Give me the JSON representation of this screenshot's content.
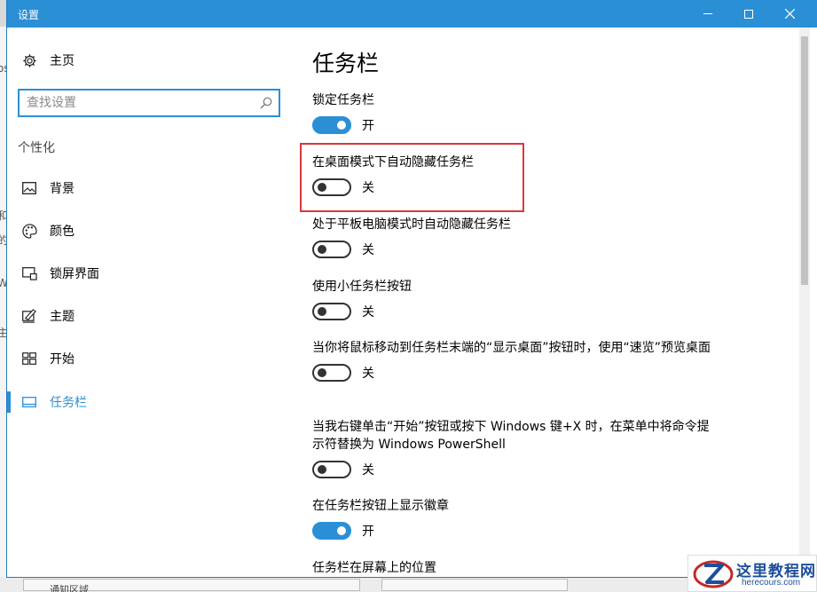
{
  "window": {
    "title": "设置"
  },
  "sidebar": {
    "home_label": "主页",
    "search_placeholder": "查找设置",
    "section": "个性化",
    "items": [
      {
        "label": "背景",
        "icon": "image-icon"
      },
      {
        "label": "颜色",
        "icon": "palette-icon"
      },
      {
        "label": "锁屏界面",
        "icon": "lock-screen-icon"
      },
      {
        "label": "主题",
        "icon": "theme-icon"
      },
      {
        "label": "开始",
        "icon": "start-icon"
      },
      {
        "label": "任务栏",
        "icon": "taskbar-icon",
        "active": true
      }
    ]
  },
  "main": {
    "title": "任务栏",
    "settings": [
      {
        "label": "锁定任务栏",
        "state": "开",
        "on": true
      },
      {
        "label": "在桌面模式下自动隐藏任务栏",
        "state": "关",
        "on": false,
        "highlighted": true
      },
      {
        "label": "处于平板电脑模式时自动隐藏任务栏",
        "state": "关",
        "on": false
      },
      {
        "label": "使用小任务栏按钮",
        "state": "关",
        "on": false
      },
      {
        "label": "当你将鼠标移动到任务栏末端的“显示桌面”按钮时，使用“速览”预览桌面",
        "state": "关",
        "on": false
      },
      {
        "label": "当我右键单击“开始”按钮或按下 Windows 键+X 时，在菜单中将命令提示符替换为 Windows PowerShell",
        "state": "关",
        "on": false
      },
      {
        "label": "在任务栏按钮上显示徽章",
        "state": "开",
        "on": true
      },
      {
        "label": "任务栏在屏幕上的位置"
      }
    ]
  },
  "background": {
    "fragment": "通知区域"
  },
  "watermark": {
    "brand": "这里教程网",
    "url": "herecours.com"
  },
  "colors": {
    "accent": "#2b8fd6",
    "highlight": "#d9363e"
  }
}
